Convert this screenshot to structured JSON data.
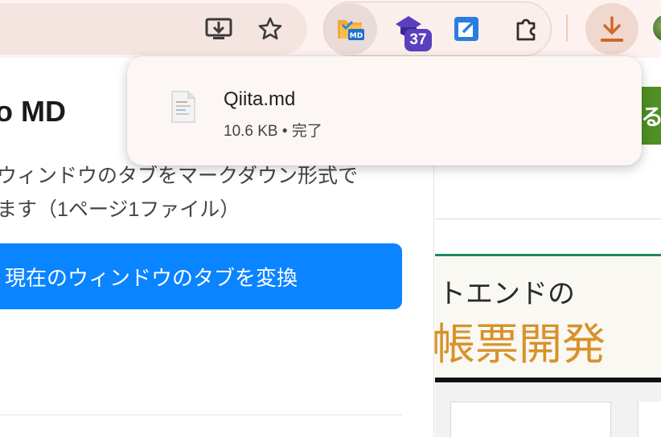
{
  "toolbar": {
    "icons": [
      "install-app-icon",
      "bookmark-star-icon",
      "save-as-md-extension-icon",
      "graduation-cap-extension-icon",
      "share-arrow-extension-icon",
      "extensions-puzzle-icon",
      "downloads-icon",
      "profile-avatar"
    ],
    "extension_badge": "37"
  },
  "download": {
    "file_name": "Qiita.md",
    "status": "10.6 KB • 完了"
  },
  "popup": {
    "title": "o MD",
    "description_line1": "ウィンドウのタブをマークダウン形式で",
    "description_line2": "ます（1ページ1ファイル）",
    "convert_button": "現在のウィンドウのタブを変換"
  },
  "background_page": {
    "green_button_glyph": "る",
    "banner_line1": "トエンドの",
    "banner_line2": "帳票開発"
  },
  "colors": {
    "accent_blue": "#0a84ff",
    "toolbar_bg": "#fdf2ef",
    "badge_purple": "#5a3fc0",
    "download_orange": "#d0692c"
  }
}
